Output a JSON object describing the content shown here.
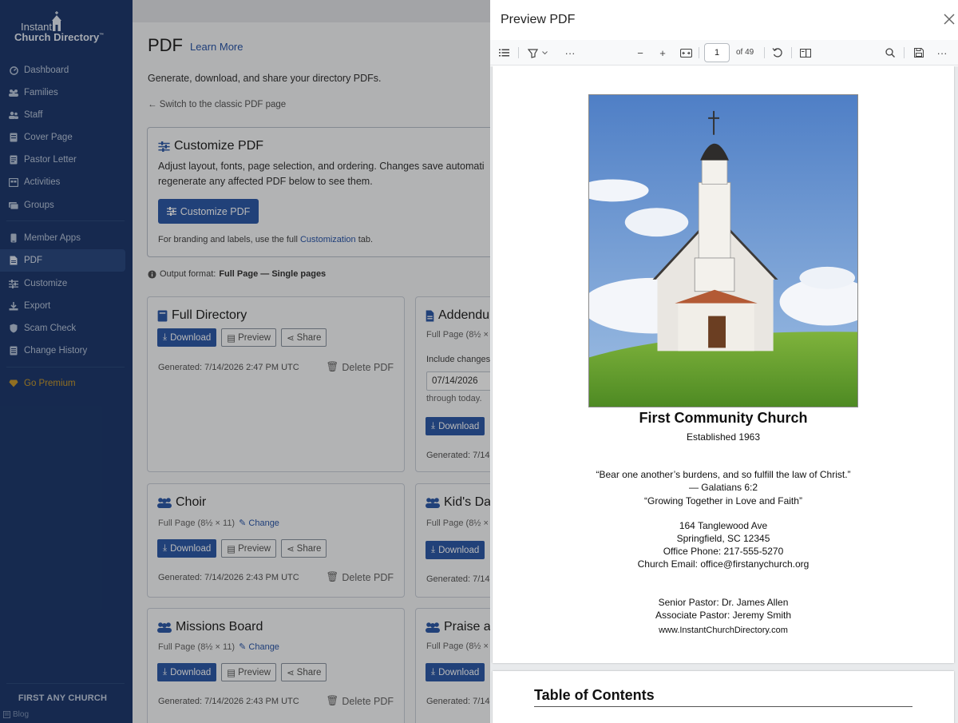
{
  "sidebar": {
    "logo_line1": "Instant",
    "logo_line2": "Church Directory",
    "logo_tm": "™",
    "items": [
      {
        "label": "Dashboard",
        "icon": "dashboard-icon"
      },
      {
        "label": "Families",
        "icon": "families-icon"
      },
      {
        "label": "Staff",
        "icon": "staff-icon"
      },
      {
        "label": "Cover Page",
        "icon": "cover-page-icon"
      },
      {
        "label": "Pastor Letter",
        "icon": "letter-icon"
      },
      {
        "label": "Activities",
        "icon": "activities-icon"
      },
      {
        "label": "Groups",
        "icon": "groups-icon"
      },
      {
        "label": "Member Apps",
        "icon": "phone-icon"
      },
      {
        "label": "PDF",
        "icon": "pdf-icon"
      },
      {
        "label": "Customize",
        "icon": "sliders-icon"
      },
      {
        "label": "Export",
        "icon": "export-icon"
      },
      {
        "label": "Scam Check",
        "icon": "shield-icon"
      },
      {
        "label": "Change History",
        "icon": "history-icon"
      },
      {
        "label": "Go Premium",
        "icon": "diamond-icon"
      }
    ],
    "church_name": "FIRST ANY CHURCH",
    "blog_label": "Blog"
  },
  "main": {
    "title": "PDF",
    "learn_more": "Learn More",
    "intro": "Generate, download, and share your directory PDFs.",
    "classic_link": "← Switch to the classic PDF page",
    "customize_box": {
      "title": "Customize PDF",
      "line1": "Adjust layout, fonts, page selection, and ordering. Changes save automati",
      "line2": "regenerate any affected PDF below to see them.",
      "button": "Customize PDF",
      "branding_prefix": "For branding and labels, use the full ",
      "branding_link": "Customization",
      "branding_suffix": " tab."
    },
    "output_prefix": "Output format: ",
    "output_value": "Full Page — Single pages",
    "buttons": {
      "download": "Download",
      "preview": "Preview",
      "share": "Share",
      "delete": "Delete PDF",
      "change": "Change"
    },
    "cards": [
      {
        "title": "Full Directory",
        "generated": "Generated: 7/14/2026 2:47 PM UTC"
      },
      {
        "title": "Addendu",
        "subtitle": "Full Page (8½ × 1",
        "include_label": "Include changes",
        "date_value": "07/14/2026",
        "through": "through today.",
        "generated": "Generated: 7/14"
      },
      {
        "title": "Choir",
        "subtitle": "Full Page (8½ × 11)",
        "generated": "Generated: 7/14/2026 2:43 PM UTC"
      },
      {
        "title": "Kid's Da",
        "subtitle": "Full Page (8½ × 1",
        "generated": "Generated: 7/14"
      },
      {
        "title": "Missions Board",
        "subtitle": "Full Page (8½ × 11)",
        "generated": "Generated: 7/14/2026 2:43 PM UTC"
      },
      {
        "title": "Praise a",
        "subtitle": "Full Page (8½ × 1",
        "generated": "Generated: 7/14"
      }
    ]
  },
  "preview": {
    "title": "Preview PDF",
    "page_number": "1",
    "of_pages": "of 49",
    "page1": {
      "church_name": "First Community Church",
      "established": "Established 1963",
      "verse": "“Bear one another’s burdens, and so fulfill the law of Christ.”",
      "verse_ref": "— Galatians 6:2",
      "motto": "“Growing Together in Love and Faith”",
      "address1": "164 Tanglewood Ave",
      "address2": "Springfield, SC 12345",
      "phone": "Office Phone: 217-555-5270",
      "email": "Church Email: office@firstanychurch.org",
      "senior_pastor": "Senior Pastor: Dr. James Allen",
      "associate_pastor": "Associate Pastor: Jeremy Smith",
      "website": "www.InstantChurchDirectory.com"
    },
    "page2_heading": "Table of Contents"
  },
  "colors": {
    "sidebar": "#1f3a6e",
    "primary": "#2f5aa8",
    "premium": "#c99a2e"
  }
}
